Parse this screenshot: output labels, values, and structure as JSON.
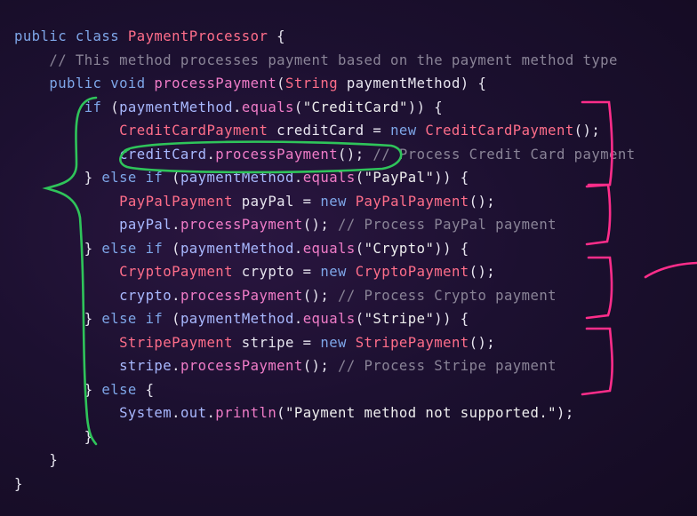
{
  "code_lines": [
    [
      [
        "kw",
        "public class "
      ],
      [
        "cls",
        "PaymentProcessor"
      ],
      [
        "pl",
        " {"
      ]
    ],
    [
      [
        "pl",
        "    "
      ],
      [
        "cm",
        "// This method processes payment based on the payment method type"
      ]
    ],
    [
      [
        "pl",
        "    "
      ],
      [
        "kw",
        "public void "
      ],
      [
        "fn",
        "processPayment"
      ],
      [
        "pl",
        "("
      ],
      [
        "cls",
        "String"
      ],
      [
        "pl",
        " paymentMethod) {"
      ]
    ],
    [
      [
        "pl",
        "        "
      ],
      [
        "kw",
        "if"
      ],
      [
        "pl",
        " ("
      ],
      [
        "var",
        "paymentMethod"
      ],
      [
        "pl",
        "."
      ],
      [
        "fn",
        "equals"
      ],
      [
        "pl",
        "("
      ],
      [
        "str",
        "\"CreditCard\""
      ],
      [
        "pl",
        ")) {"
      ]
    ],
    [
      [
        "pl",
        "            "
      ],
      [
        "cls",
        "CreditCardPayment"
      ],
      [
        "pl",
        " creditCard = "
      ],
      [
        "kw",
        "new "
      ],
      [
        "cls",
        "CreditCardPayment"
      ],
      [
        "pl",
        "();"
      ]
    ],
    [
      [
        "pl",
        "            "
      ],
      [
        "var",
        "creditCard"
      ],
      [
        "pl",
        "."
      ],
      [
        "fn",
        "processPayment"
      ],
      [
        "pl",
        "(); "
      ],
      [
        "cm",
        "// Process Credit Card payment"
      ]
    ],
    [
      [
        "pl",
        "        } "
      ],
      [
        "kw",
        "else if"
      ],
      [
        "pl",
        " ("
      ],
      [
        "var",
        "paymentMethod"
      ],
      [
        "pl",
        "."
      ],
      [
        "fn",
        "equals"
      ],
      [
        "pl",
        "("
      ],
      [
        "str",
        "\"PayPal\""
      ],
      [
        "pl",
        ")) {"
      ]
    ],
    [
      [
        "pl",
        "            "
      ],
      [
        "cls",
        "PayPalPayment"
      ],
      [
        "pl",
        " payPal = "
      ],
      [
        "kw",
        "new "
      ],
      [
        "cls",
        "PayPalPayment"
      ],
      [
        "pl",
        "();"
      ]
    ],
    [
      [
        "pl",
        "            "
      ],
      [
        "var",
        "payPal"
      ],
      [
        "pl",
        "."
      ],
      [
        "fn",
        "processPayment"
      ],
      [
        "pl",
        "(); "
      ],
      [
        "cm",
        "// Process PayPal payment"
      ]
    ],
    [
      [
        "pl",
        "        } "
      ],
      [
        "kw",
        "else if"
      ],
      [
        "pl",
        " ("
      ],
      [
        "var",
        "paymentMethod"
      ],
      [
        "pl",
        "."
      ],
      [
        "fn",
        "equals"
      ],
      [
        "pl",
        "("
      ],
      [
        "str",
        "\"Crypto\""
      ],
      [
        "pl",
        ")) {"
      ]
    ],
    [
      [
        "pl",
        "            "
      ],
      [
        "cls",
        "CryptoPayment"
      ],
      [
        "pl",
        " crypto = "
      ],
      [
        "kw",
        "new "
      ],
      [
        "cls",
        "CryptoPayment"
      ],
      [
        "pl",
        "();"
      ]
    ],
    [
      [
        "pl",
        "            "
      ],
      [
        "var",
        "crypto"
      ],
      [
        "pl",
        "."
      ],
      [
        "fn",
        "processPayment"
      ],
      [
        "pl",
        "(); "
      ],
      [
        "cm",
        "// Process Crypto payment"
      ]
    ],
    [
      [
        "pl",
        "        } "
      ],
      [
        "kw",
        "else if"
      ],
      [
        "pl",
        " ("
      ],
      [
        "var",
        "paymentMethod"
      ],
      [
        "pl",
        "."
      ],
      [
        "fn",
        "equals"
      ],
      [
        "pl",
        "("
      ],
      [
        "str",
        "\"Stripe\""
      ],
      [
        "pl",
        ")) {"
      ]
    ],
    [
      [
        "pl",
        "            "
      ],
      [
        "cls",
        "StripePayment"
      ],
      [
        "pl",
        " stripe = "
      ],
      [
        "kw",
        "new "
      ],
      [
        "cls",
        "StripePayment"
      ],
      [
        "pl",
        "();"
      ]
    ],
    [
      [
        "pl",
        "            "
      ],
      [
        "var",
        "stripe"
      ],
      [
        "pl",
        "."
      ],
      [
        "fn",
        "processPayment"
      ],
      [
        "pl",
        "(); "
      ],
      [
        "cm",
        "// Process Stripe payment"
      ]
    ],
    [
      [
        "pl",
        "        } "
      ],
      [
        "kw",
        "else"
      ],
      [
        "pl",
        " {"
      ]
    ],
    [
      [
        "pl",
        "            "
      ],
      [
        "var",
        "System"
      ],
      [
        "pl",
        "."
      ],
      [
        "var",
        "out"
      ],
      [
        "pl",
        "."
      ],
      [
        "fn",
        "println"
      ],
      [
        "pl",
        "("
      ],
      [
        "str",
        "\"Payment method not supported.\""
      ],
      [
        "pl",
        ");"
      ]
    ],
    [
      [
        "pl",
        "        }"
      ]
    ],
    [
      [
        "pl",
        "    }"
      ]
    ],
    [
      [
        "pl",
        "}"
      ]
    ]
  ],
  "theme": {
    "background": "#1c1030",
    "keyword": "#7ea6e8",
    "class_name": "#ff6e8a",
    "method": "#f07cc8",
    "variable": "#a9b9ff",
    "string": "#eeeeee",
    "comment": "#8a8497",
    "annotation_green": "#2fc45a",
    "annotation_pink": "#ff2d8a"
  }
}
